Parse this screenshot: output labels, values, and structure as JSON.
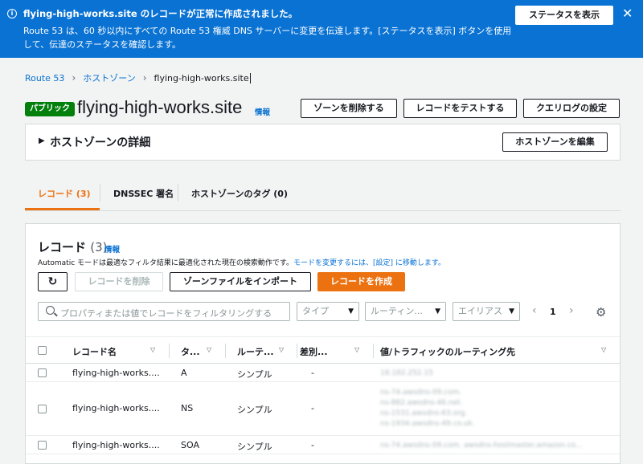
{
  "banner": {
    "title": "flying-high-works.site のレコードが正常に作成されました。",
    "message": "Route 53 は、60 秒以内にすべての Route 53 権威 DNS サーバーに変更を伝達します。[ステータスを表示] ボタンを使用して、伝達のステータスを確認します。",
    "status_button": "ステータスを表示",
    "close": "✕",
    "color": "#0972d3"
  },
  "breadcrumb": {
    "items": [
      "Route 53",
      "ホストゾーン",
      "flying-high-works.site"
    ]
  },
  "header": {
    "badge": "パブリック",
    "title": "flying-high-works.site",
    "info": "情報",
    "buttons": {
      "delete_zone": "ゾーンを削除する",
      "test_record": "レコードをテストする",
      "query_log": "クエリログの設定"
    }
  },
  "details": {
    "label": "ホストゾーンの詳細",
    "edit_button": "ホストゾーンを編集"
  },
  "tabs": [
    {
      "label": "レコード (3)",
      "active": true
    },
    {
      "label": "DNSSEC 署名",
      "active": false
    },
    {
      "label": "ホストゾーンのタグ (0)",
      "active": false
    }
  ],
  "records": {
    "title": "レコード",
    "count": "(3)",
    "info": "情報",
    "desc_prefix": "Automatic モードは最適なフィルタ結果に最適化された現在の検索動作です。",
    "desc_link": "モードを変更するには、[設定] に移動します。",
    "buttons": {
      "delete": "レコードを削除",
      "import": "ゾーンファイルをインポート",
      "create": "レコードを作成"
    },
    "search_placeholder": "プロパティまたは値でレコードをフィルタリングする",
    "filters": {
      "type": "タイプ",
      "routing": "ルーティン...",
      "alias": "エイリアス"
    },
    "page": "1",
    "columns": [
      "レコード名",
      "タ...",
      "ルーテ...",
      "差別...",
      "値/トラフィックのルーティング先"
    ],
    "rows": [
      {
        "name": "flying-high-works....",
        "type": "A",
        "routing": "シンプル",
        "diff": "-",
        "values": [
          "18.182.252.15"
        ]
      },
      {
        "name": "flying-high-works....",
        "type": "NS",
        "routing": "シンプル",
        "diff": "-",
        "values": [
          "ns-74.awsdns-09.com.",
          "ns-882.awsdns-46.net.",
          "ns-1531.awsdns-63.org.",
          "ns-1934.awsdns-49.co.uk."
        ]
      },
      {
        "name": "flying-high-works....",
        "type": "SOA",
        "routing": "シンプル",
        "diff": "-",
        "values": [
          "ns-74.awsdns-09.com. awsdns-hostmaster.amazon.co..."
        ]
      }
    ]
  }
}
